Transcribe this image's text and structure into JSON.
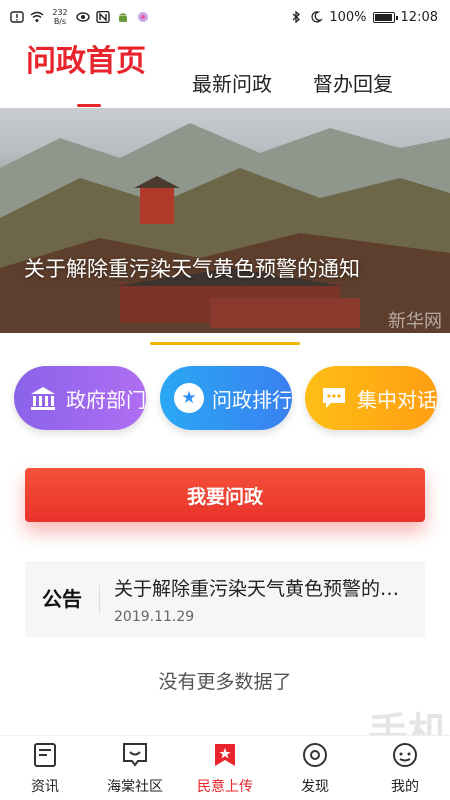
{
  "status_bar": {
    "net_speed_value": "232",
    "net_speed_unit": "B/s",
    "battery": "100%",
    "battery_level": 1.0,
    "time": "12:08"
  },
  "tabs": [
    {
      "label": "问政首页",
      "active": true
    },
    {
      "label": "最新问政",
      "active": false
    },
    {
      "label": "督办回复",
      "active": false
    }
  ],
  "banner": {
    "caption": "关于解除重污染天气黄色预警的通知",
    "watermark": "新华网"
  },
  "categories": [
    {
      "label": "政府部门",
      "icon": "building-icon"
    },
    {
      "label": "问政排行",
      "icon": "rank-icon"
    },
    {
      "label": "集中对话",
      "icon": "chat-icon"
    }
  ],
  "ask_button": "我要问政",
  "notice": {
    "tag": "公告",
    "title": "关于解除重污染天气黄色预警的通知",
    "date": "2019.11.29"
  },
  "no_more": "没有更多数据了",
  "bottom_nav": [
    {
      "label": "资讯",
      "icon": "news-icon",
      "active": false
    },
    {
      "label": "海棠社区",
      "icon": "community-icon",
      "active": false
    },
    {
      "label": "民意上传",
      "icon": "upload-icon",
      "active": true
    },
    {
      "label": "发现",
      "icon": "discover-icon",
      "active": false
    },
    {
      "label": "我的",
      "icon": "profile-icon",
      "active": false
    }
  ],
  "colors": {
    "accent": "#e8242c",
    "gov": "#8a63ea",
    "rank": "#2f8ff2",
    "talk": "#ffae14",
    "indicator": "#f0b400"
  },
  "watermark": "手机"
}
